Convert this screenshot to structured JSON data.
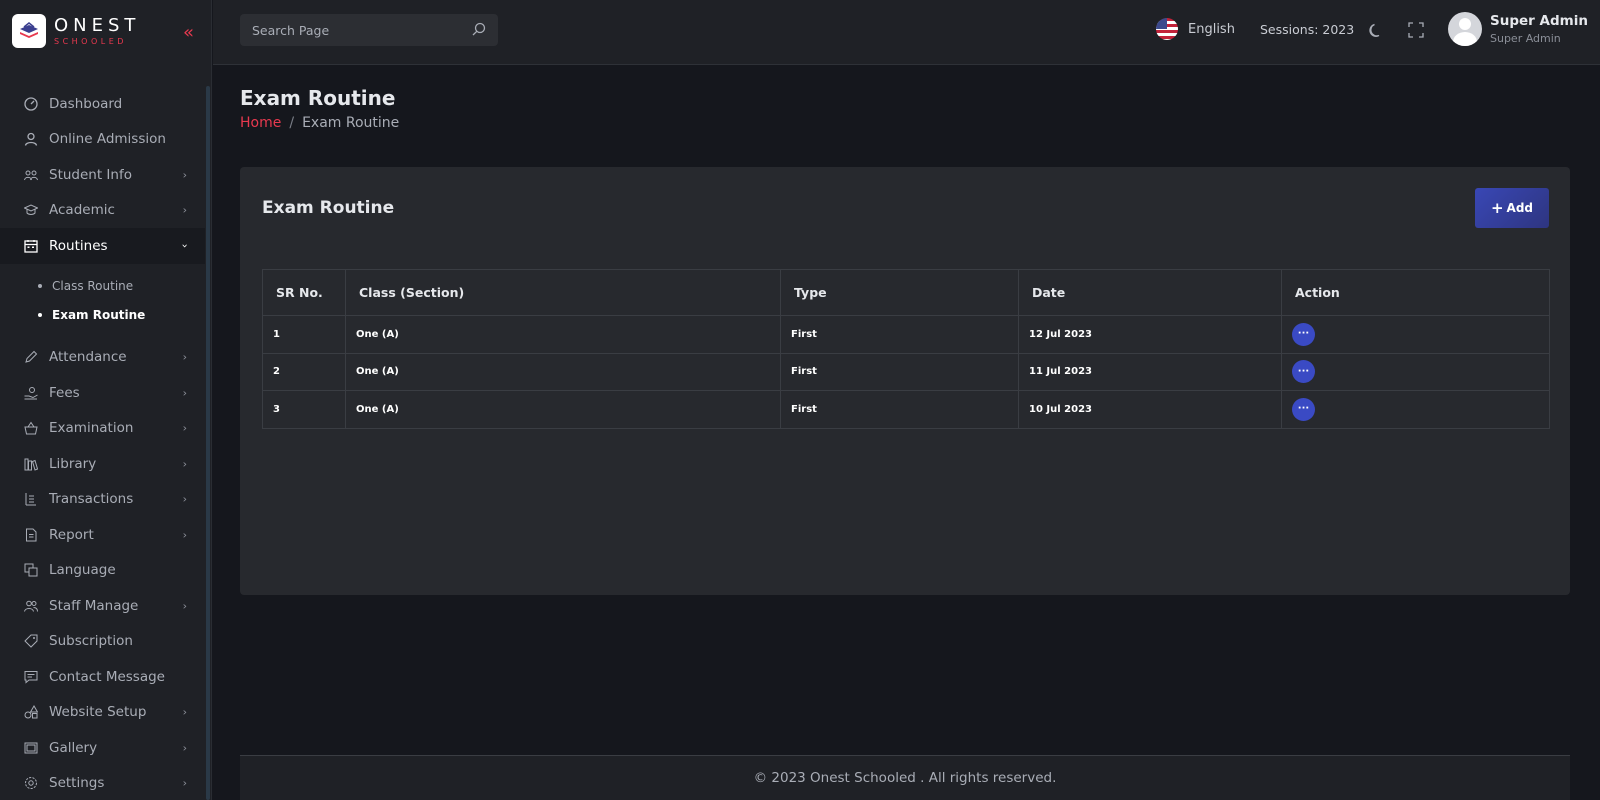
{
  "brand": {
    "name": "ONEST",
    "tagline": "SCHOOLED"
  },
  "header": {
    "search_placeholder": "Search Page",
    "language": "English",
    "sessions": "Sessions: 2023",
    "user": {
      "name": "Super Admin",
      "role": "Super Admin"
    }
  },
  "sidebar": {
    "items": [
      {
        "label": "Dashboard",
        "icon": "dashboard-icon",
        "has_children": false
      },
      {
        "label": "Online Admission",
        "icon": "user-icon",
        "has_children": false
      },
      {
        "label": "Student Info",
        "icon": "students-icon",
        "has_children": true
      },
      {
        "label": "Academic",
        "icon": "graduation-cap-icon",
        "has_children": true
      },
      {
        "label": "Routines",
        "icon": "calendar-icon",
        "has_children": true,
        "expanded": true,
        "children": [
          {
            "label": "Class Routine",
            "active": false
          },
          {
            "label": "Exam Routine",
            "active": true
          }
        ]
      },
      {
        "label": "Attendance",
        "icon": "pen-icon",
        "has_children": true
      },
      {
        "label": "Fees",
        "icon": "money-hand-icon",
        "has_children": true
      },
      {
        "label": "Examination",
        "icon": "basket-icon",
        "has_children": true
      },
      {
        "label": "Library",
        "icon": "books-icon",
        "has_children": true
      },
      {
        "label": "Transactions",
        "icon": "transaction-icon",
        "has_children": true
      },
      {
        "label": "Report",
        "icon": "document-icon",
        "has_children": true
      },
      {
        "label": "Language",
        "icon": "translate-icon",
        "has_children": false
      },
      {
        "label": "Staff Manage",
        "icon": "users-icon",
        "has_children": true
      },
      {
        "label": "Subscription",
        "icon": "tag-icon",
        "has_children": false
      },
      {
        "label": "Contact Message",
        "icon": "message-icon",
        "has_children": false
      },
      {
        "label": "Website Setup",
        "icon": "shapes-icon",
        "has_children": true
      },
      {
        "label": "Gallery",
        "icon": "gallery-icon",
        "has_children": true
      },
      {
        "label": "Settings",
        "icon": "gear-icon",
        "has_children": true
      }
    ]
  },
  "page": {
    "title": "Exam Routine",
    "breadcrumb": {
      "home": "Home",
      "separator": "/",
      "current": "Exam Routine"
    }
  },
  "card": {
    "title": "Exam Routine",
    "add_label": "Add",
    "columns": [
      "SR No.",
      "Class (Section)",
      "Type",
      "Date",
      "Action"
    ],
    "rows": [
      {
        "sr": "1",
        "class": "One (A)",
        "type": "First",
        "date": "12 Jul 2023"
      },
      {
        "sr": "2",
        "class": "One (A)",
        "type": "First",
        "date": "11 Jul 2023"
      },
      {
        "sr": "3",
        "class": "One (A)",
        "type": "First",
        "date": "10 Jul 2023"
      }
    ],
    "action_glyph": "···"
  },
  "footer": {
    "text": "© 2023 Onest Schooled . All rights reserved."
  },
  "colors": {
    "accent": "#e8394f",
    "primary_button": "#3947b5",
    "background": "#15171d",
    "panel": "#27292e"
  }
}
